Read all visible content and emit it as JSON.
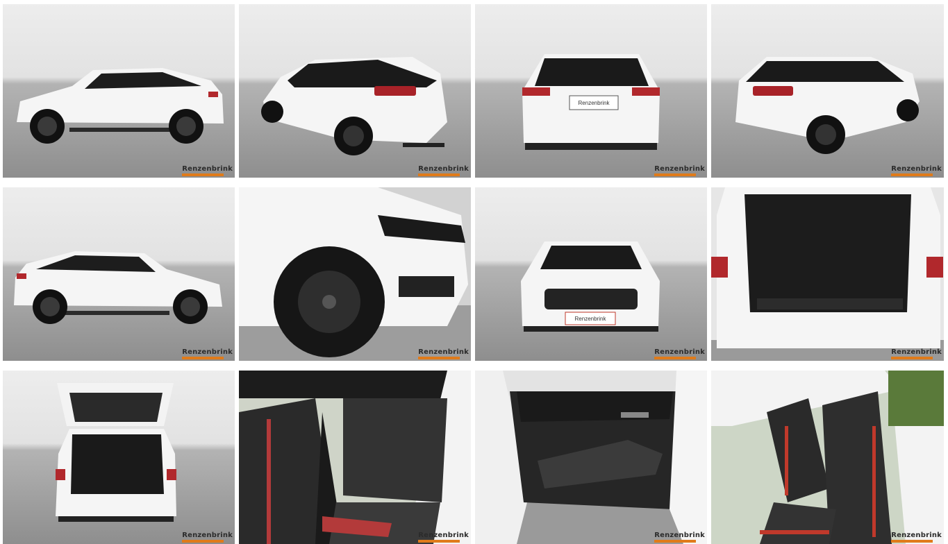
{
  "gallery": {
    "dealer_logo_text": "Renzenbrink",
    "images": [
      {
        "id": "side-left",
        "alt": "side view left"
      },
      {
        "id": "rear-three-quarter-left",
        "alt": "rear three-quarter left"
      },
      {
        "id": "rear",
        "alt": "rear view"
      },
      {
        "id": "rear-three-quarter-right",
        "alt": "rear three-quarter right"
      },
      {
        "id": "side-right",
        "alt": "side view right"
      },
      {
        "id": "front-wheel-detail",
        "alt": "front wheel detail"
      },
      {
        "id": "front",
        "alt": "front view"
      },
      {
        "id": "trunk-open-close",
        "alt": "open trunk"
      },
      {
        "id": "tailgate-open",
        "alt": "tailgate open"
      },
      {
        "id": "rear-seats",
        "alt": "rear seats"
      },
      {
        "id": "door-panel",
        "alt": "door panel"
      },
      {
        "id": "front-seats",
        "alt": "front seats"
      }
    ]
  },
  "plate_text": "Renzenbrink",
  "colors": {
    "sky_top": "#e9e9e9",
    "floor": "#9a9a9a",
    "car_body": "#f4f4f4",
    "accent_red": "#c0392b",
    "logo_orange": "#e07b1a"
  }
}
